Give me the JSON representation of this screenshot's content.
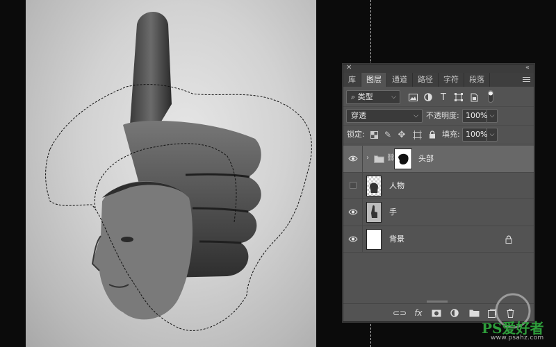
{
  "panel": {
    "tabs": [
      {
        "label": "库"
      },
      {
        "label": "图层"
      },
      {
        "label": "通道"
      },
      {
        "label": "路径"
      },
      {
        "label": "字符"
      },
      {
        "label": "段落"
      }
    ],
    "filter": {
      "label": "类型"
    },
    "blend": {
      "mode": "穿透",
      "opacity_label": "不透明度:",
      "opacity_value": "100%"
    },
    "lock": {
      "label": "锁定:",
      "fill_label": "填充:",
      "fill_value": "100%"
    },
    "layers": [
      {
        "name": "头部",
        "visible": true,
        "type": "group",
        "has_mask": true
      },
      {
        "name": "人物",
        "visible": false,
        "type": "pixel"
      },
      {
        "name": "手",
        "visible": true,
        "type": "pixel"
      },
      {
        "name": "背景",
        "visible": true,
        "type": "background",
        "locked": true
      }
    ],
    "bottom_icons": [
      "link-icon",
      "fx-icon",
      "mask-icon",
      "adjustment-icon",
      "folder-icon",
      "new-layer-icon",
      "trash-icon"
    ],
    "bottom_fx": "fx"
  },
  "watermark": {
    "brand": "PS爱好者",
    "site": "www.psahz.com"
  },
  "colors": {
    "panel_bg": "#535353",
    "tab_bar": "#3e3e3e",
    "selected_layer": "#686868",
    "canvas_bg": "#0b0b0b"
  }
}
